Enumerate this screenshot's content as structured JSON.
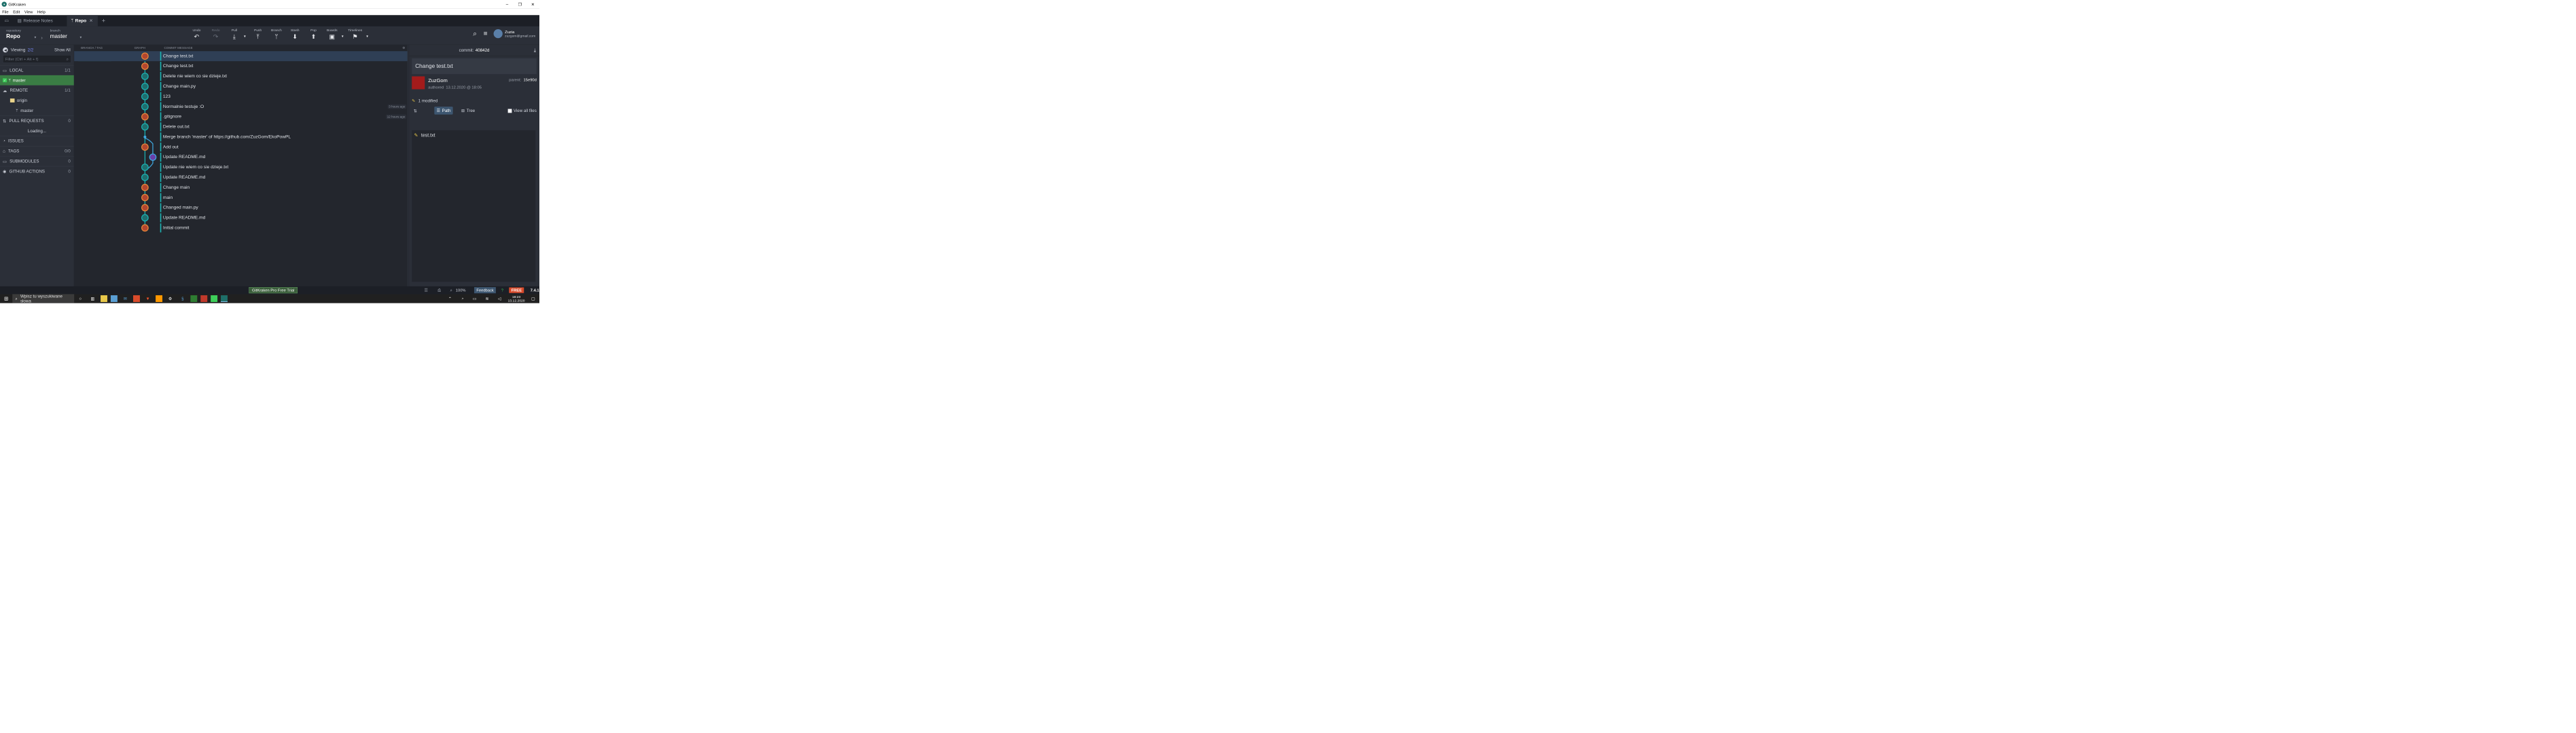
{
  "app_title": "GitKraken",
  "menu": [
    "File",
    "Edit",
    "View",
    "Help"
  ],
  "tabs": {
    "release_notes": "Release Notes",
    "repo": "Repo"
  },
  "toolbar": {
    "repo_label": "repository",
    "repo_value": "Repo",
    "branch_label": "branch",
    "branch_value": "master",
    "undo": "Undo",
    "redo": "Redo",
    "pull": "Pull",
    "push": "Push",
    "branch": "Branch",
    "stash": "Stash",
    "pop": "Pop",
    "boards": "Boards",
    "timelines": "Timelines"
  },
  "profile": {
    "name": "Zuzia",
    "email": "zuzgom@gmail.com"
  },
  "left": {
    "viewing": "Viewing",
    "viewing_count": "2/2",
    "show_all": "Show All",
    "filter_placeholder": "Filter (Ctrl + Alt + f)",
    "local": "LOCAL",
    "local_count": "1/1",
    "local_branch": "master",
    "remote": "REMOTE",
    "remote_count": "1/1",
    "origin": "origin",
    "origin_branch": "master",
    "pull_requests": "PULL REQUESTS",
    "pr_count": "0",
    "loading": "Loading...",
    "issues": "ISSUES",
    "tags": "TAGS",
    "tags_count": "0/0",
    "submodules": "SUBMODULES",
    "submodules_count": "0",
    "github_actions": "GITHUB ACTIONS",
    "gha_count": "0"
  },
  "graph": {
    "headers": {
      "branch": "BRANCH / TAG",
      "graph": "GRAPH",
      "message": "COMMIT MESSAGE"
    },
    "branch_label": "master",
    "commits": [
      {
        "msg": "Change test.txt",
        "avatar": "orange",
        "time": ""
      },
      {
        "msg": "Change test.txt",
        "avatar": "orange",
        "time": ""
      },
      {
        "msg": "Delete nie wiem co sie dzieje.txt",
        "avatar": "teal",
        "time": ""
      },
      {
        "msg": "Change main.py",
        "avatar": "teal",
        "time": ""
      },
      {
        "msg": "123",
        "avatar": "teal",
        "time": ""
      },
      {
        "msg": "Normalnie testuje :O",
        "avatar": "teal",
        "time": "3 hours ago"
      },
      {
        "msg": ".gitignore",
        "avatar": "orange",
        "time": "12 hours ago"
      },
      {
        "msg": "Delete out.txt",
        "avatar": "teal",
        "time": ""
      },
      {
        "msg": "Merge branch 'master' of https://github.com/ZuzGom/EkoPowPL",
        "avatar": "merge",
        "time": ""
      },
      {
        "msg": "Add out",
        "avatar": "orange",
        "time": ""
      },
      {
        "msg": "Update README.md",
        "avatar": "blue",
        "time": ""
      },
      {
        "msg": "Update nie wiem co sie dzieje.txt",
        "avatar": "teal",
        "time": ""
      },
      {
        "msg": "Update README.md",
        "avatar": "teal",
        "time": ""
      },
      {
        "msg": "Change main",
        "avatar": "orange",
        "time": ""
      },
      {
        "msg": "main",
        "avatar": "orange",
        "time": ""
      },
      {
        "msg": "Changed main.py",
        "avatar": "orange",
        "time": ""
      },
      {
        "msg": "Update README.md",
        "avatar": "teal",
        "time": ""
      },
      {
        "msg": "Initial commit",
        "avatar": "orange",
        "time": ""
      }
    ]
  },
  "right": {
    "commit_label": "commit:",
    "commit_sha": "40842d",
    "title": "Change test.txt",
    "author": "ZuzGom",
    "authored": "authored",
    "date": "13.12.2020 @ 18:05",
    "parent_label": "parent:",
    "parent_sha": "15e90d",
    "modified": "1 modified",
    "path": "Path",
    "tree": "Tree",
    "view_all": "View all files",
    "file": "test.txt"
  },
  "status": {
    "trial": "GitKraken Pro Free Trial",
    "zoom": "100%",
    "feedback": "Feedback",
    "free": "FREE",
    "version": "7.4.1"
  },
  "taskbar": {
    "search_placeholder": "Wpisz tu wyszukiwane słowa",
    "time": "18:23",
    "date": "13.12.2020"
  }
}
